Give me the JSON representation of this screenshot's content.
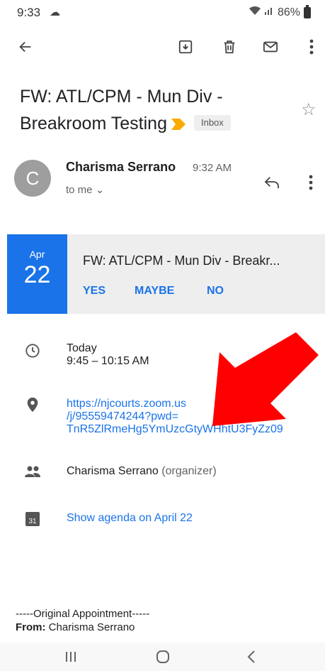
{
  "status": {
    "time": "9:33",
    "battery": "86%"
  },
  "toolbar": {
    "icons": [
      "back-arrow-icon",
      "archive-icon",
      "delete-icon",
      "mark-unread-icon",
      "more-vert-icon"
    ]
  },
  "email": {
    "subject": "FW: ATL/CPM - Mun Div - Breakroom Testing",
    "label_chip": "Inbox",
    "sender": {
      "avatar_letter": "C",
      "name": "Charisma Serrano",
      "time": "9:32 AM",
      "recipient": "to me"
    }
  },
  "event": {
    "month": "Apr",
    "day": "22",
    "title": "FW: ATL/CPM - Mun Div - Breakr...",
    "rsvp": {
      "yes": "YES",
      "maybe": "MAYBE",
      "no": "NO"
    },
    "when_day": "Today",
    "when_time": "9:45 – 10:15 AM",
    "location_lines": [
      "https://njcourts.zoom.us",
      "/j/95559474244?pwd=",
      "TnR5ZlRmeHg5YmUzcGtyWHhtU3FyZz09"
    ],
    "organizer_name": "Charisma Serrano",
    "organizer_role": "(organizer)",
    "calendar_day": "31",
    "agenda_link": "Show agenda on April 22"
  },
  "body": {
    "original_header": "-----Original Appointment-----",
    "from_label": "From:",
    "from_value": "Charisma Serrano"
  },
  "colors": {
    "accent": "#1a73e8",
    "annotation_arrow": "#ff0000",
    "label_arrow": "#f9ab00"
  }
}
